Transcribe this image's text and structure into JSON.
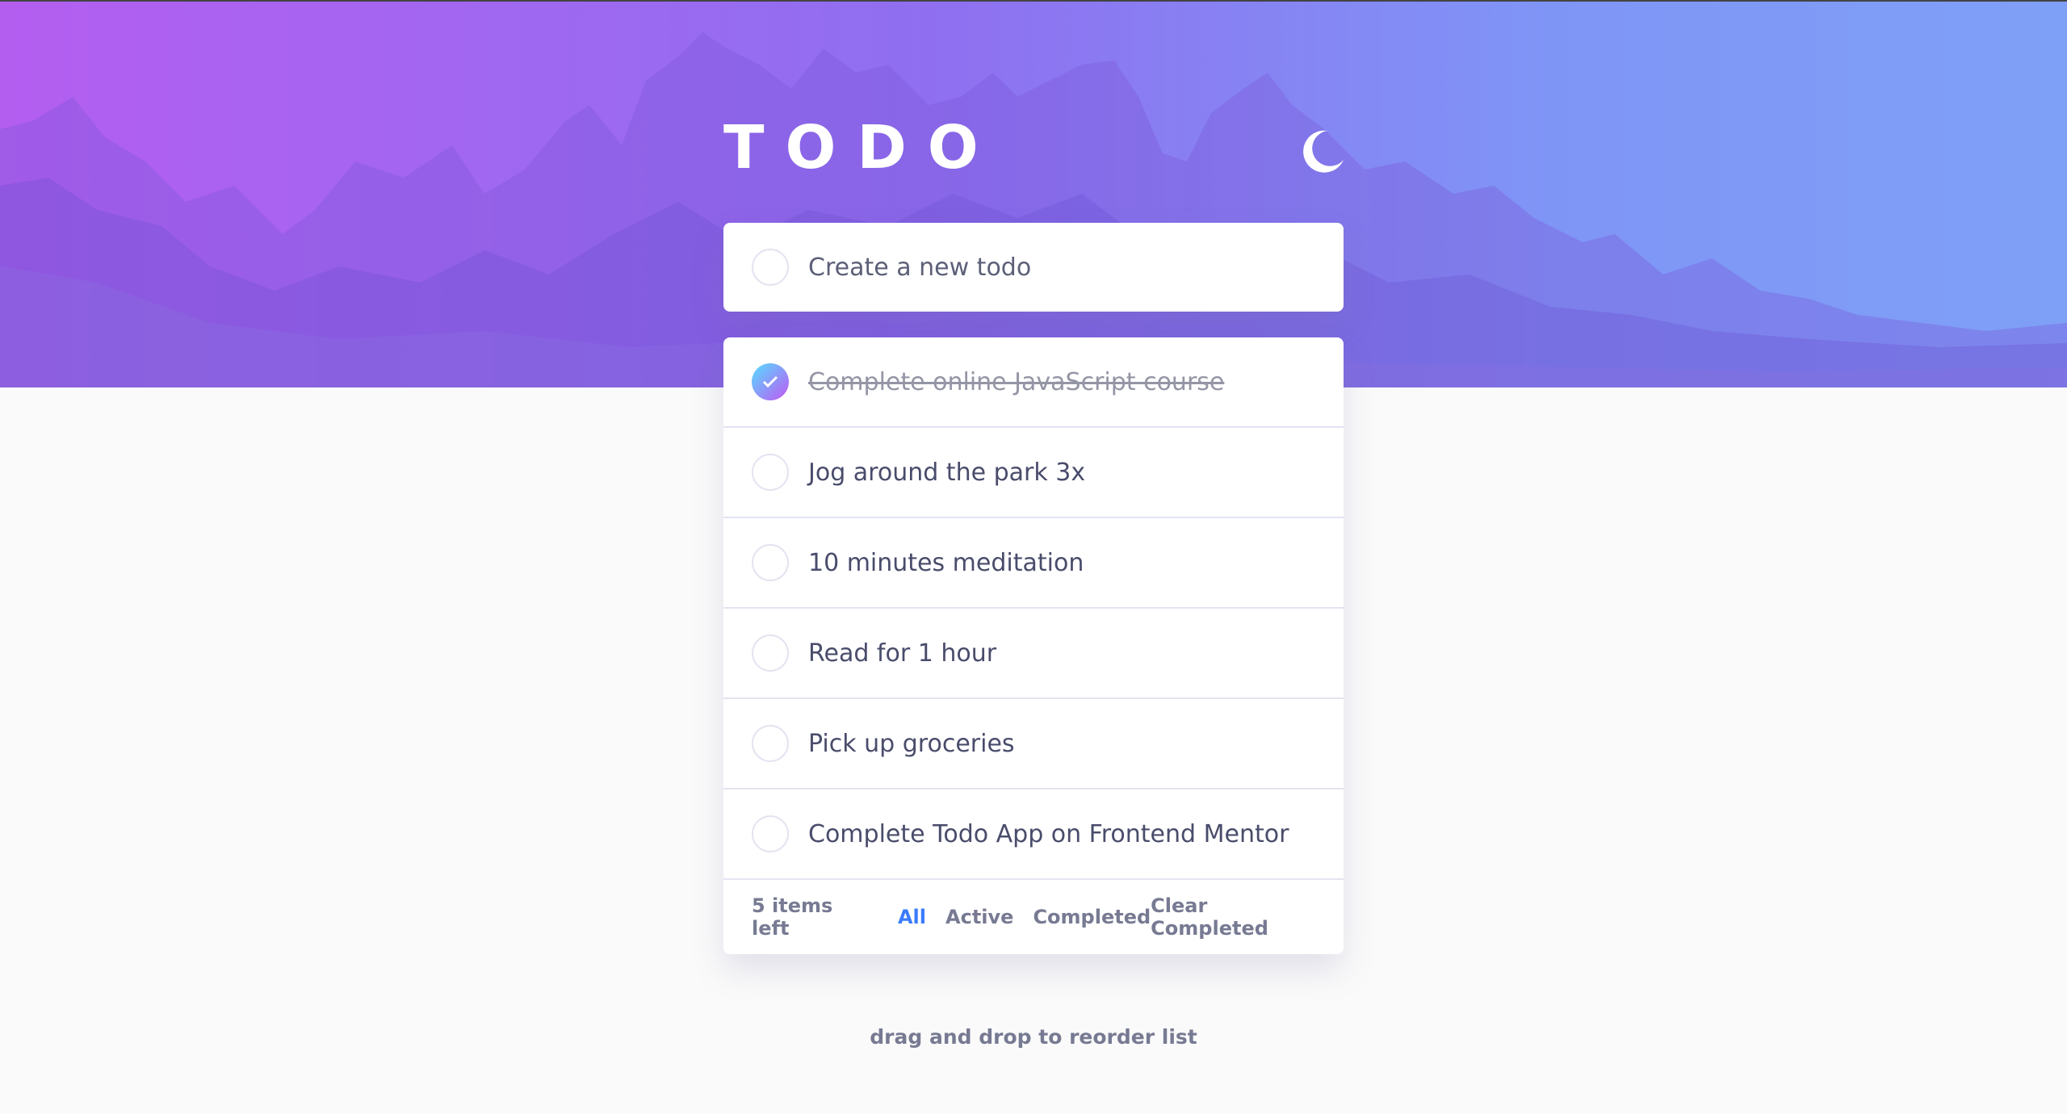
{
  "app": {
    "title": "TODO"
  },
  "theme_toggle": {
    "icon": "moon-icon"
  },
  "new_todo": {
    "placeholder": "Create a new todo",
    "value": ""
  },
  "todos": [
    {
      "text": "Complete online JavaScript course",
      "completed": true
    },
    {
      "text": "Jog around the park 3x",
      "completed": false
    },
    {
      "text": "10 minutes meditation",
      "completed": false
    },
    {
      "text": "Read for 1 hour",
      "completed": false
    },
    {
      "text": "Pick up groceries",
      "completed": false
    },
    {
      "text": "Complete Todo App on Frontend Mentor",
      "completed": false
    }
  ],
  "footer": {
    "items_left": "5 items left",
    "filters": [
      "All",
      "Active",
      "Completed"
    ],
    "active_filter": "All",
    "clear_label": "Clear Completed"
  },
  "hint": "drag and drop to reorder list",
  "colors": {
    "accent": "#3a7cfd",
    "check_gradient_start": "#55ddff",
    "check_gradient_end": "#c058f3",
    "text": "#494c6b",
    "muted": "#777a92"
  }
}
